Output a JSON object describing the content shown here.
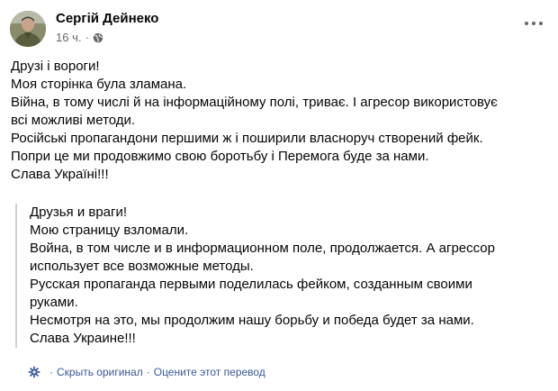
{
  "post": {
    "author": "Сергій Дейнеко",
    "time": "16 ч.",
    "separator": "·",
    "audience_icon": "globe-icon",
    "more_icon": "more-options-icon",
    "original_lines": [
      "Друзі і вороги!",
      "Моя сторінка була зламана.",
      "Війна, в тому числі й на інформаційному полі, триває. І агресор використовує",
      "всі можливі методи.",
      "Російські пропагандони першими ж і поширили власноруч створений фейк.",
      "Попри це ми продовжимо свою боротьбу і Перемога  буде за нами.",
      "Слава Україні!!!"
    ],
    "translated_lines": [
      "Друзья и враги!",
      "Мою страницу взломали.",
      "Война, в том числе и в информационном поле, продолжается. А агрессор",
      "использует все возможные методы.",
      "Русская пропаганда первыми поделилась фейком, созданным своими",
      "руками.",
      "Несмотря на это, мы продолжим нашу борьбу и победа будет за нами.",
      "Слава Украине!!!"
    ]
  },
  "translation_footer": {
    "icon": "translate-gear-icon",
    "hide_original": "Скрыть оригинал",
    "separator": "·",
    "rate_translation": "Оцените этот перевод"
  },
  "colors": {
    "link": "#385898",
    "secondary_text": "#65676b",
    "quote_border": "#ced0d4"
  }
}
